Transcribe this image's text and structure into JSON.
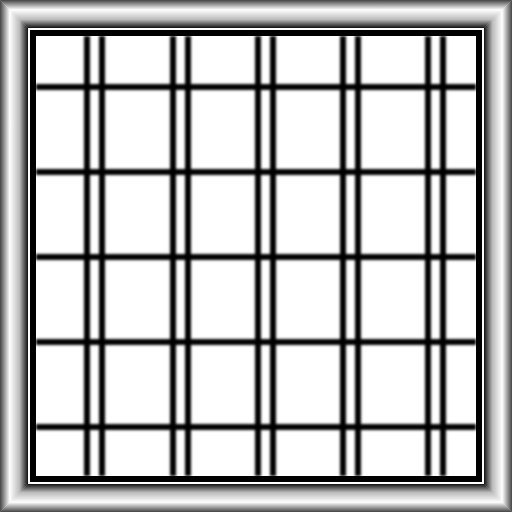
{
  "colors": {
    "background": "#ffffff",
    "line": "#000000",
    "frame_dark": "#111111",
    "frame_light": "#ffffff"
  },
  "grid": {
    "vertical_groups": 5,
    "horizontal_groups": 5,
    "line_style": "double-line with white glow"
  }
}
